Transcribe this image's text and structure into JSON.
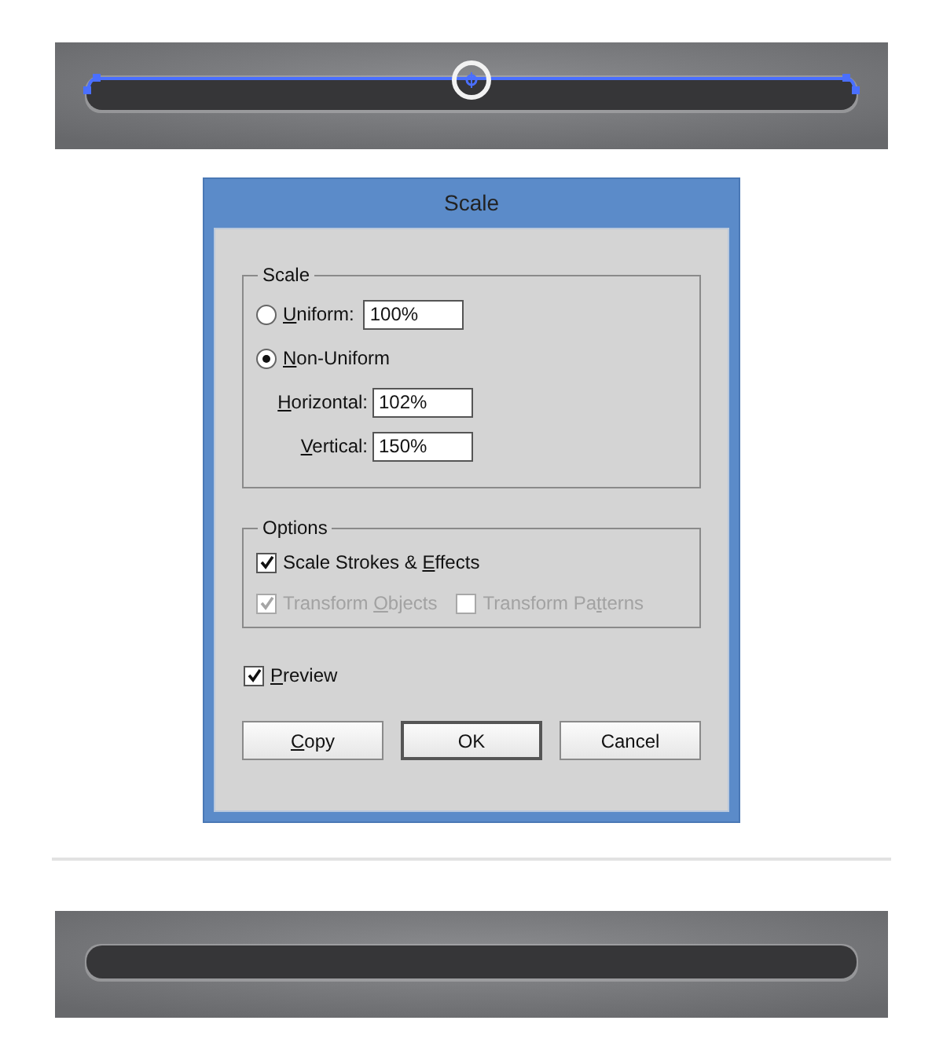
{
  "dialog": {
    "title": "Scale"
  },
  "scale_group": {
    "legend": "Scale",
    "rows": [
      {
        "kind": "radio",
        "label": {
          "key": "U",
          "after": "niform:"
        },
        "selected": false,
        "value": "100%"
      },
      {
        "kind": "radio",
        "label": {
          "key": "N",
          "after": "on-Uniform"
        },
        "selected": true
      },
      {
        "kind": "field",
        "label": {
          "key": "H",
          "after": "orizontal:"
        },
        "value": "102%"
      },
      {
        "kind": "field",
        "label": {
          "key": "V",
          "after": "ertical:"
        },
        "value": "150%"
      }
    ]
  },
  "options_group": {
    "legend": "Options",
    "checkboxes": [
      {
        "label": {
          "before": "Scale Strokes & ",
          "key": "E",
          "after": "ffects"
        },
        "checked": true,
        "disabled": false
      },
      {
        "label": {
          "before": "Transform ",
          "key": "O",
          "after": "bjects"
        },
        "checked": true,
        "disabled": true
      },
      {
        "label": {
          "before": "Transform Pa",
          "key": "t",
          "after": "terns"
        },
        "checked": false,
        "disabled": true
      }
    ]
  },
  "preview": {
    "label": {
      "key": "P",
      "after": "review"
    },
    "checked": true
  },
  "buttons": [
    {
      "label": {
        "key": "C",
        "after": "opy"
      },
      "default": false
    },
    {
      "label": {
        "before": "OK"
      },
      "default": true
    },
    {
      "label": {
        "before": "Cancel"
      },
      "default": false
    }
  ]
}
